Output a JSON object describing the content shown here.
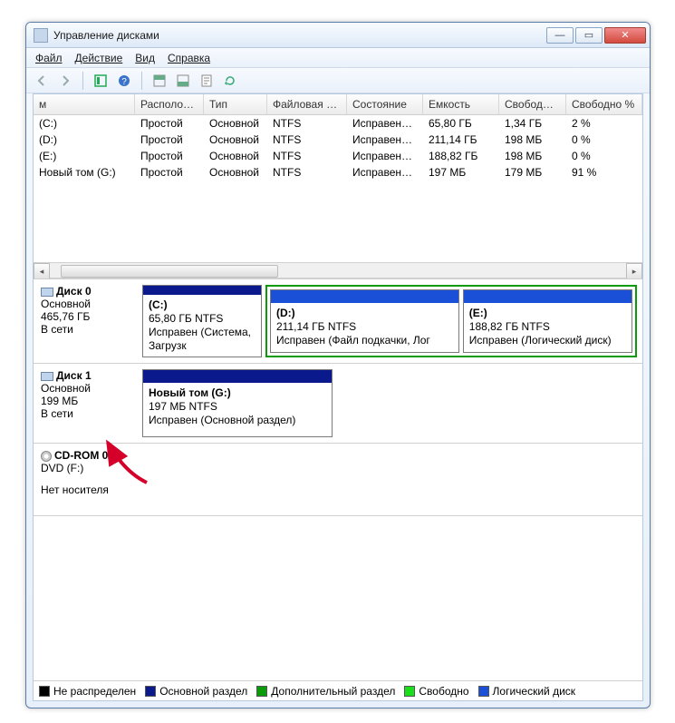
{
  "window": {
    "title": "Управление дисками"
  },
  "menu": {
    "file": "Файл",
    "action": "Действие",
    "view": "Вид",
    "help": "Справка"
  },
  "grid": {
    "headers": [
      "м",
      "Располо…",
      "Тип",
      "Файловая с…",
      "Состояние",
      "Емкость",
      "Свобод…",
      "Свободно %"
    ],
    "rows": [
      {
        "c0": "(C:)",
        "c1": "Простой",
        "c2": "Основной",
        "c3": "NTFS",
        "c4": "Исправен…",
        "c5": "65,80 ГБ",
        "c6": "1,34 ГБ",
        "c7": "2 %"
      },
      {
        "c0": "(D:)",
        "c1": "Простой",
        "c2": "Основной",
        "c3": "NTFS",
        "c4": "Исправен…",
        "c5": "211,14 ГБ",
        "c6": "198 МБ",
        "c7": "0 %"
      },
      {
        "c0": "(E:)",
        "c1": "Простой",
        "c2": "Основной",
        "c3": "NTFS",
        "c4": "Исправен…",
        "c5": "188,82 ГБ",
        "c6": "198 МБ",
        "c7": "0 %"
      },
      {
        "c0": "Новый том (G:)",
        "c1": "Простой",
        "c2": "Основной",
        "c3": "NTFS",
        "c4": "Исправен…",
        "c5": "197 МБ",
        "c6": "179 МБ",
        "c7": "91 %"
      }
    ]
  },
  "disks": {
    "d0": {
      "name": "Диск 0",
      "type": "Основной",
      "size": "465,76 ГБ",
      "state": "В сети",
      "p_c": {
        "label": "(C:)",
        "size": "65,80 ГБ NTFS",
        "status": "Исправен (Система, Загрузк"
      },
      "p_d": {
        "label": "(D:)",
        "size": "211,14 ГБ NTFS",
        "status": "Исправен (Файл подкачки, Лог"
      },
      "p_e": {
        "label": "(E:)",
        "size": "188,82 ГБ NTFS",
        "status": "Исправен (Логический диск)"
      }
    },
    "d1": {
      "name": "Диск 1",
      "type": "Основной",
      "size": "199 МБ",
      "state": "В сети",
      "p_g": {
        "label": "Новый том  (G:)",
        "size": "197 МБ NTFS",
        "status": "Исправен (Основной раздел)"
      }
    },
    "cd": {
      "name": "CD-ROM 0",
      "type": "DVD (F:)",
      "state": "Нет носителя"
    }
  },
  "legend": {
    "unalloc": "Не распределен",
    "primary": "Основной раздел",
    "extended": "Дополнительный раздел",
    "free": "Свободно",
    "logical": "Логический диск"
  }
}
